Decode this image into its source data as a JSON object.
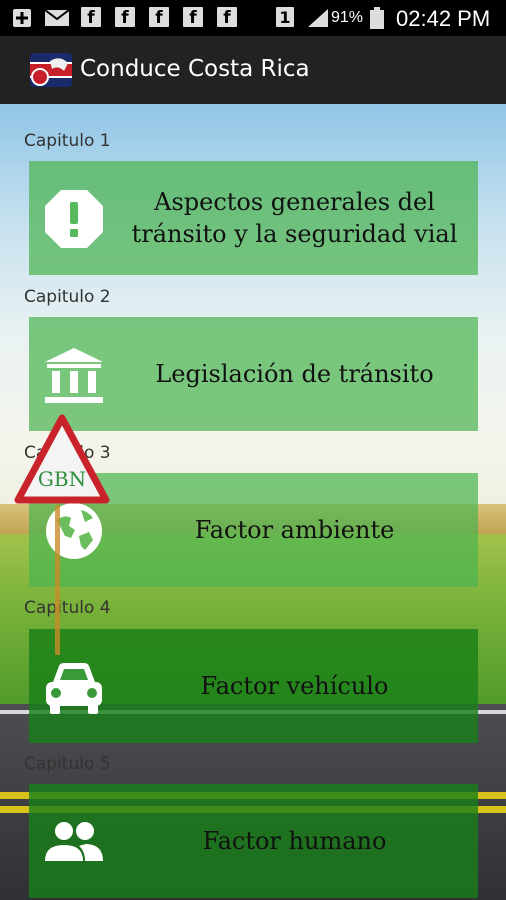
{
  "status_bar": {
    "fb_glyph": "f",
    "notification_badge": "1",
    "battery": "91%",
    "time": "02:42 PM"
  },
  "app_bar": {
    "title": "Conduce Costa Rica"
  },
  "chapters": [
    {
      "label": "Capitulo 1",
      "title_lines": [
        "Aspectos generales del",
        "tránsito y la seguridad vial"
      ],
      "icon": "alert-octagon-icon"
    },
    {
      "label": "Capitulo 2",
      "title": "Legislación de tránsito",
      "icon": "bank-building-icon"
    },
    {
      "label": "Capitulo 3",
      "title": "Factor ambiente",
      "icon": "globe-icon"
    },
    {
      "label": "Capitulo 4",
      "title": "Factor vehículo",
      "icon": "car-icon"
    },
    {
      "label": "Capitulo 5",
      "title": "Factor humano",
      "icon": "people-icon"
    }
  ],
  "sign_logo_text": "GBN",
  "colors": {
    "card_light": "#4cb450",
    "card_dark": "#188018",
    "status_bar": "#000000",
    "action_bar": "#222222"
  }
}
